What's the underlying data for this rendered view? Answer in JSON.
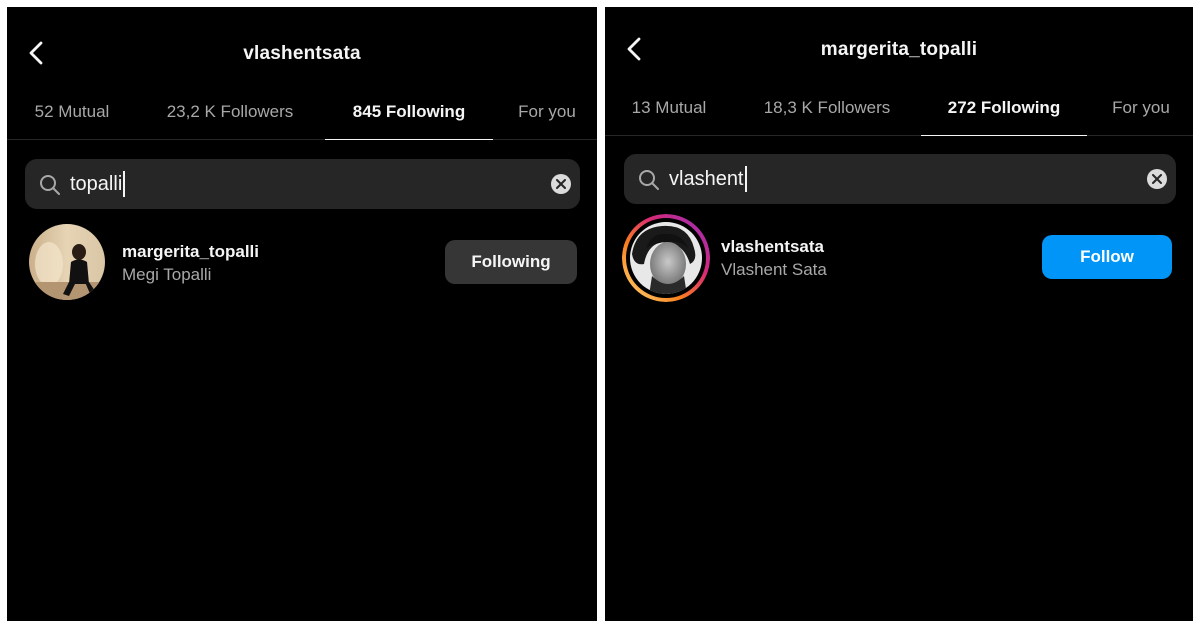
{
  "left": {
    "title": "vlashentsata",
    "tabs": [
      {
        "label": "52 Mutual"
      },
      {
        "label": "23,2 K Followers"
      },
      {
        "label": "845 Following"
      },
      {
        "label": "For you"
      }
    ],
    "active_tab": "845 Following",
    "search": {
      "value": "topalli"
    },
    "result": {
      "username": "margerita_topalli",
      "full_name": "Megi Topalli",
      "button_label": "Following"
    }
  },
  "right": {
    "title": "margerita_topalli",
    "tabs": [
      {
        "label": "13 Mutual"
      },
      {
        "label": "18,3 K Followers"
      },
      {
        "label": "272 Following"
      },
      {
        "label": "For you"
      }
    ],
    "active_tab": "272 Following",
    "search": {
      "value": "vlashent"
    },
    "result": {
      "username": "vlashentsata",
      "full_name": "Vlashent Sata",
      "button_label": "Follow",
      "story_ring": true
    }
  },
  "colors": {
    "background": "#000000",
    "search_bg": "#262626",
    "following_button": "#363636",
    "follow_button": "#0095f6",
    "secondary_text": "#a8a8a8"
  }
}
